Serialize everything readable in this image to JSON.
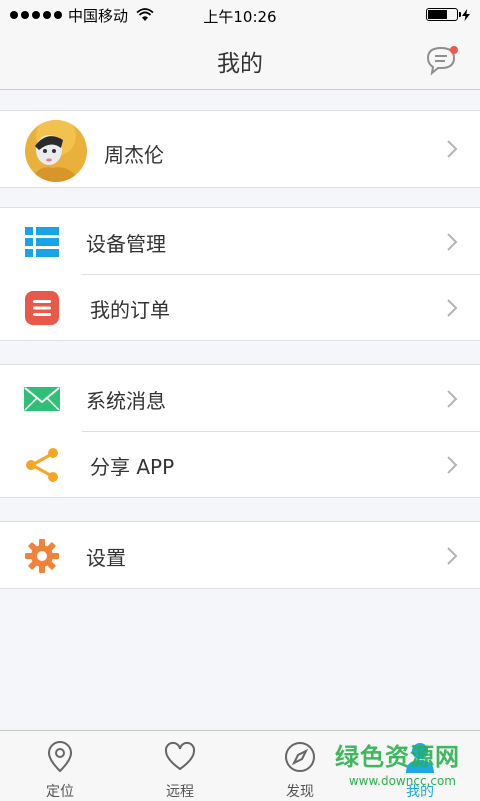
{
  "status_bar": {
    "carrier": "中国移动",
    "time": "上午10:26",
    "battery_level": 0.7
  },
  "nav": {
    "title": "我的",
    "message_icon": "chat-bubble-icon",
    "message_badge_color": "#f0584c"
  },
  "profile": {
    "name": "周杰伦"
  },
  "groups": [
    {
      "items": [
        {
          "label": "设备管理",
          "icon": "list-icon",
          "color": "#1aa3e8"
        },
        {
          "label": "我的订单",
          "icon": "menu-icon",
          "color": "#e8594a"
        }
      ]
    },
    {
      "items": [
        {
          "label": "系统消息",
          "icon": "envelope-icon",
          "color": "#2fbf76"
        },
        {
          "label": "分享 APP",
          "icon": "share-icon",
          "color": "#f5a623"
        }
      ]
    },
    {
      "items": [
        {
          "label": "设置",
          "icon": "gear-icon",
          "color": "#f0823a"
        }
      ]
    }
  ],
  "tabs": [
    {
      "label": "定位",
      "icon": "location-pin-icon"
    },
    {
      "label": "远程",
      "icon": "heart-icon"
    },
    {
      "label": "发现",
      "icon": "compass-icon"
    },
    {
      "label": "我的",
      "icon": "person-icon",
      "active": true
    }
  ],
  "watermark": {
    "text": "绿色资源网",
    "url": "www.downcc.com"
  }
}
